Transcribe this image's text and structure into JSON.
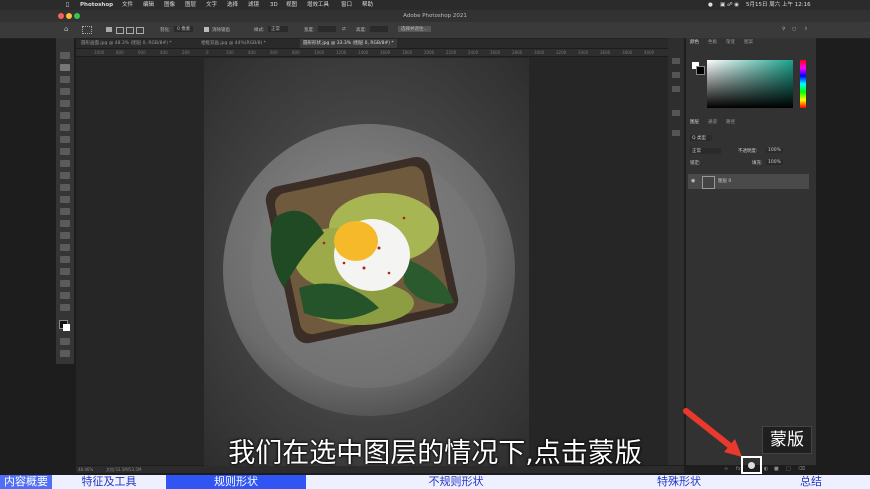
{
  "menubar": {
    "app": "Photoshop",
    "items": [
      "文件",
      "编辑",
      "图像",
      "图层",
      "文字",
      "选择",
      "滤镜",
      "3D",
      "视图",
      "增效工具",
      "窗口",
      "帮助"
    ],
    "clock": "5月15日 周六 上午 12:16"
  },
  "window": {
    "title": "Adobe Photoshop 2021"
  },
  "options_bar": {
    "feather_label": "羽化:",
    "feather_value": "0 像素",
    "antialias_label": "消除锯齿",
    "style_label": "样式:",
    "style_value": "正常",
    "width_label": "宽度:",
    "height_label": "高度:",
    "select_mask_label": "选择并遮住..."
  },
  "tabs": [
    {
      "label": "圆形画面.jpg @ 48.3% (图层 0, RGB/8#) *",
      "active": false
    },
    {
      "label": "相框双画.jpg @ 44%(RGB/8) *",
      "active": false
    },
    {
      "label": "圆形形状.jpg @ 33.3% (图层 0, RGB/8#) *",
      "active": true
    }
  ],
  "ruler_ticks": [
    "1000",
    "800",
    "600",
    "400",
    "200",
    "0",
    "200",
    "400",
    "600",
    "800",
    "1000",
    "1200",
    "1400",
    "1600",
    "1800",
    "2000",
    "2200",
    "2400",
    "2600",
    "2800",
    "3000",
    "3200",
    "3400",
    "3600",
    "3800",
    "4000"
  ],
  "right_panel": {
    "color_tabs": [
      "颜色",
      "色板",
      "渐变",
      "图案"
    ],
    "layer_tabs": [
      "图层",
      "通道",
      "路径"
    ],
    "kind_label": "Q 类型",
    "blend_mode": "正常",
    "opacity_label": "不透明度:",
    "opacity_value": "100%",
    "lock_label": "锁定:",
    "fill_label": "填充:",
    "fill_value": "100%",
    "layer_name": "图层 0"
  },
  "status": {
    "zoom": "48.46%",
    "doc": "文档:53.5M/53.5M"
  },
  "subtitle": "我们在选中图层的情况下,点击蒙版",
  "callout": "蒙版",
  "bottom_nav": [
    {
      "label": "内容概要",
      "state": "first"
    },
    {
      "label": "特征及工具",
      "state": "normal"
    },
    {
      "label": "规则形状",
      "state": "active"
    },
    {
      "label": "不规则形状",
      "state": "normal"
    },
    {
      "label": "特殊形状",
      "state": "normal"
    },
    {
      "label": "总结",
      "state": "normal"
    }
  ],
  "colors": {
    "accent": "#2f56f4",
    "arrow": "#e8392c",
    "nav_bg": "#eef0ff"
  }
}
